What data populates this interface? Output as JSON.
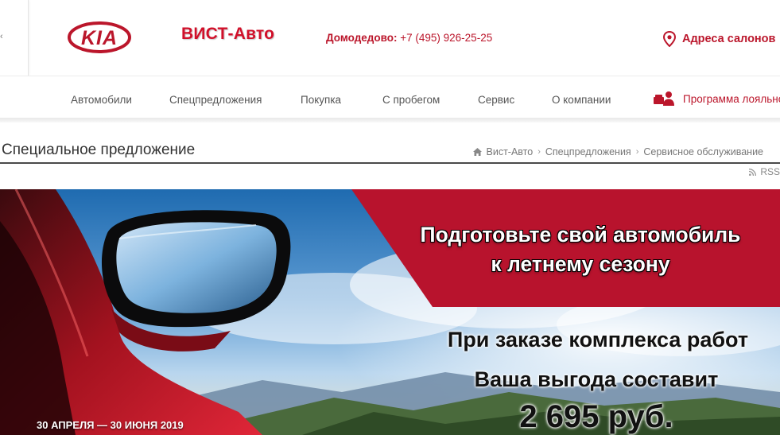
{
  "header": {
    "left_tick": "‹",
    "brand_logo_text": "KIA",
    "dealer_name": "ВИСТ-Авто",
    "phone_city": "Домодедово:",
    "phone_number": "+7 (495) 926-25-25",
    "addresses_label": "Адреса салонов",
    "icons": {
      "location": "map-pin-icon"
    },
    "brand_color": "#bb162b"
  },
  "nav": {
    "items": [
      {
        "label": "Автомобили"
      },
      {
        "label": "Спецпредложения"
      },
      {
        "label": "Покупка"
      },
      {
        "label": "С пробегом"
      },
      {
        "label": "Сервис"
      },
      {
        "label": "О компании"
      }
    ],
    "loyalty_label": "Программа лояльности",
    "icons": {
      "loyalty": "loyalty-people-icon"
    }
  },
  "page": {
    "title": "Специальное предложение",
    "breadcrumb": [
      {
        "label": "Вист-Авто"
      },
      {
        "label": "Спецпредложения"
      },
      {
        "label": "Сервисное обслуживание"
      }
    ],
    "breadcrumb_separator": "›",
    "rss_label": "RSS",
    "icons": {
      "home": "home-icon",
      "rss": "rss-icon"
    }
  },
  "banner": {
    "headline_line1": "Подготовьте свой автомобиль",
    "headline_line2": "к летнему сезону",
    "offer_line1": "При заказе комплекса работ",
    "offer_line2": "Ваша выгода составит",
    "offer_amount": "2 695 руб.",
    "dates": "30 АПРЕЛЯ — 30 ИЮНЯ 2019",
    "accent_color": "#b8132d"
  }
}
